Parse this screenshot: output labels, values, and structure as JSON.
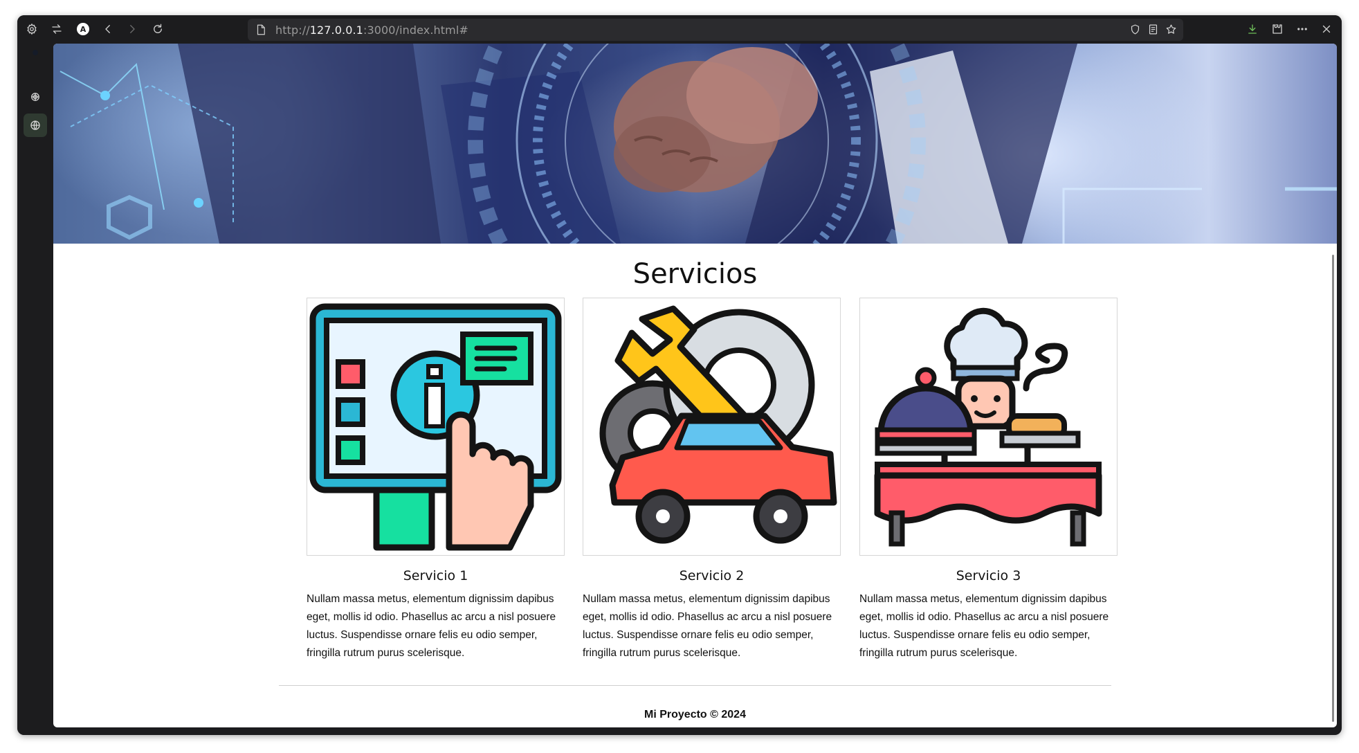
{
  "browser": {
    "url_scheme": "http://",
    "url_host": "127.0.0.1",
    "url_rest": ":3000/index.html#",
    "profile_initial": "A"
  },
  "hero": {
    "image": "team-fist-bump-tech-overlay"
  },
  "page": {
    "title": "Servicios"
  },
  "services": [
    {
      "title": "Servicio 1",
      "text": "Nullam massa metus, elementum dignissim dapibus eget, mollis id odio. Phasellus ac arcu a nisl posuere luctus. Suspendisse ornare felis eu odio semper, fringilla rutrum purus scelerisque.",
      "icon": "info-touch-screen-icon"
    },
    {
      "title": "Servicio 2",
      "text": "Nullam massa metus, elementum dignissim dapibus eget, mollis id odio. Phasellus ac arcu a nisl posuere luctus. Suspendisse ornare felis eu odio semper, fringilla rutrum purus scelerisque.",
      "icon": "car-repair-wrench-gear-icon"
    },
    {
      "title": "Servicio 3",
      "text": "Nullam massa metus, elementum dignissim dapibus eget, mollis id odio. Phasellus ac arcu a nisl posuere luctus. Suspendisse ornare felis eu odio semper, fringilla rutrum purus scelerisque.",
      "icon": "chef-catering-buffet-icon"
    }
  ],
  "footer": {
    "text": "Mi Proyecto © 2024"
  },
  "colors": {
    "browser_chrome": "#1c1c1e",
    "urlbar": "#2b2b2e",
    "sidebar_active": "#2f3a31",
    "page_bg": "#ffffff",
    "text": "#111111"
  }
}
